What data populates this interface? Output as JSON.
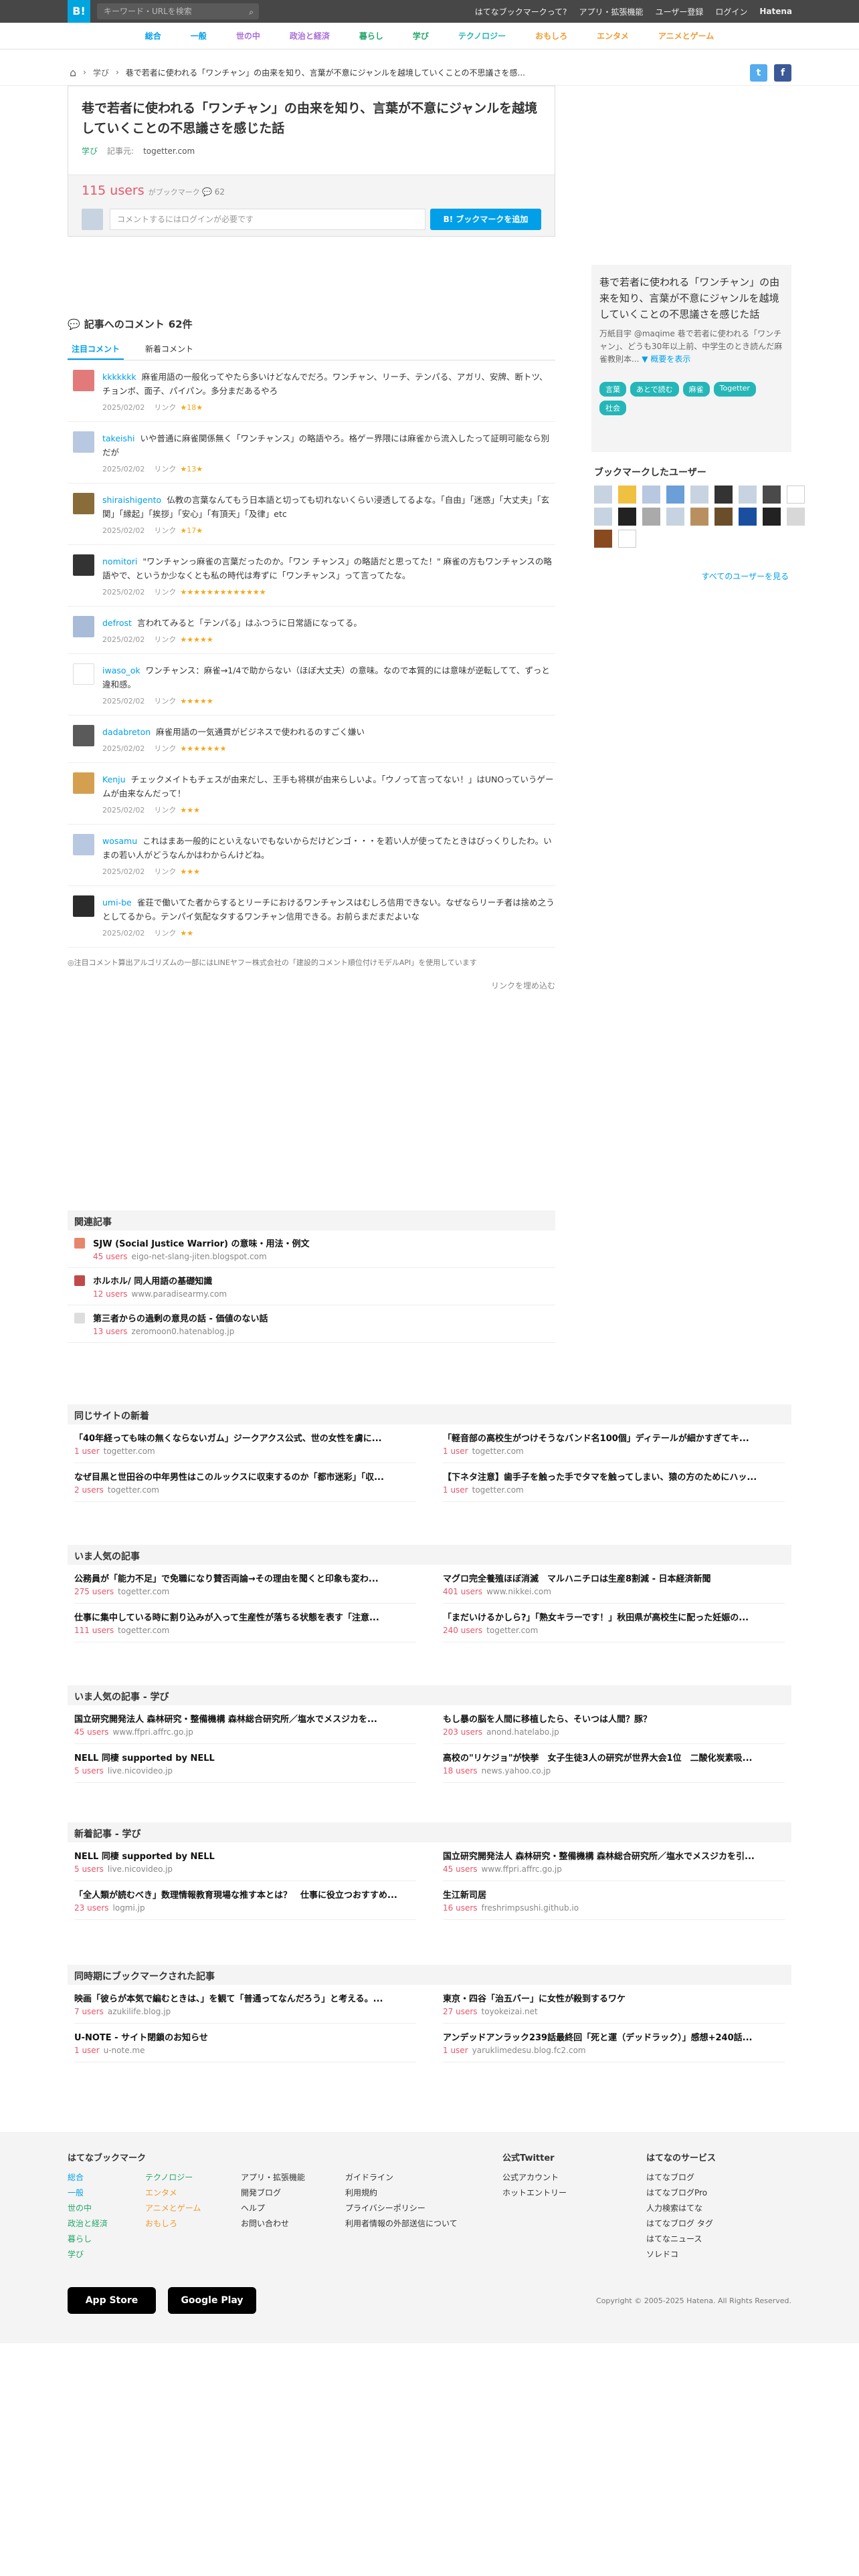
{
  "topbar": {
    "logo": "B!",
    "search_placeholder": "キーワード・URLを検索",
    "links": [
      "はてなブックマークって?",
      "アプリ・拡張機能",
      "ユーザー登録",
      "ログイン",
      "Hatena"
    ]
  },
  "nav": [
    "総合",
    "一般",
    "世の中",
    "政治と経済",
    "暮らし",
    "学び",
    "テクノロジー",
    "おもしろ",
    "エンタメ",
    "アニメとゲーム"
  ],
  "breadcrumb": {
    "home": "⌂",
    "category": "学び",
    "title": "巷で若者に使われる「ワンチャン」の由来を知り、言葉が不意にジャンルを越境していくことの不思議さを感..."
  },
  "share": {
    "twitter": "t",
    "facebook": "f"
  },
  "entry": {
    "title": "巷で若者に使われる「ワンチャン」の由来を知り、言葉が不意にジャンルを越境していくことの不思議さを感じた話",
    "category": "学び",
    "source_label": "記事元:",
    "domain": "togetter.com",
    "users": "115 users",
    "users_suffix": "がブックマーク",
    "comment_count": "62",
    "comment_placeholder": "コメントするにはログインが必要です",
    "add_button": "B! ブックマークを追加"
  },
  "comments": {
    "heading": "記事へのコメント",
    "count": "62件",
    "tabs": [
      "注目コメント",
      "新着コメント"
    ],
    "items": [
      {
        "user": "kkkkkkk",
        "text": "麻雀用語の一般化ってやたら多いけどなんでだろ。ワンチャン、リーチ、テンパる、アガリ、安牌、断トツ、チョンボ、面子、パイパン。多分まだあるやろ",
        "date": "2025/02/02",
        "link": "リンク",
        "stars": "★18★",
        "avatar_color": "#e27a7a"
      },
      {
        "user": "takeishi",
        "text": "いや普通に麻雀関係無く「ワンチャンス」の略語やろ。格ゲー界隈には麻雀から流入したって証明可能なら別だが",
        "date": "2025/02/02",
        "link": "リンク",
        "stars": "★13★",
        "avatar_color": "#b8c8e0"
      },
      {
        "user": "shiraishigento",
        "text": "仏教の言葉なんてもう日本語と切っても切れないくらい浸透してるよな。「自由」「迷惑」「大丈夫」「玄関」「縁起」「挨拶」「安心」「有頂天」「及律」etc",
        "date": "2025/02/02",
        "link": "リンク",
        "stars": "★17★",
        "avatar_color": "#8a6b3a"
      },
      {
        "user": "nomitori",
        "text": "\"ワンチャンっ麻雀の言葉だったのか。「ワン チャンス」の略語だと思ってた！\" 麻雀の方もワンチャンスの略語やで、というか少なくとも私の時代は寿ずに「ワンチャンス」って言ってたな。",
        "date": "2025/02/02",
        "link": "リンク",
        "stars": "★★★★★★★★★★★★★",
        "avatar_color": "#333333"
      },
      {
        "user": "defrost",
        "text": "言われてみると「テンパる」はふつうに日常語になってる。",
        "date": "2025/02/02",
        "link": "リンク",
        "stars": "★★★★★",
        "avatar_color": "#a8bcd8"
      },
      {
        "user": "iwaso_ok",
        "text": "ワンチャンス：麻雀→1/4で助からない（ほぼ大丈夫）の意味。なので本質的には意味が逆転してて、ずっと違和感。",
        "date": "2025/02/02",
        "link": "リンク",
        "stars": "★★★★★",
        "avatar_color": "#ffffff"
      },
      {
        "user": "dadabreton",
        "text": "麻雀用語の一気通貫がビジネスで使われるのすごく嫌い",
        "date": "2025/02/02",
        "link": "リンク",
        "stars": "★★★★★★★",
        "avatar_color": "#5a5a5a"
      },
      {
        "user": "Kenju",
        "text": "チェックメイトもチェスが由来だし、王手も将棋が由来らしいよ。「ウノって言ってない！」はUNOっていうゲームが由来なんだって！",
        "date": "2025/02/02",
        "link": "リンク",
        "stars": "★★★",
        "avatar_color": "#d4a050"
      },
      {
        "user": "wosamu",
        "text": "これはまあ一般的にといえないでもないからだけどンゴ・・・を若い人が使ってたときはびっくりしたわ。いまの若い人がどうなんかはわからんけどね。",
        "date": "2025/02/02",
        "link": "リンク",
        "stars": "★★★",
        "avatar_color": "#b8c8e0"
      },
      {
        "user": "umi-be",
        "text": "雀荘で働いてた者からするとリーチにおけるワンチャンスはむしろ信用できない。なぜならリーチ者は捨め之うとしてるから。テンパイ気配なタするワンチャン信用できる。お前らまだまだよいな",
        "date": "2025/02/02",
        "link": "リンク",
        "stars": "★★",
        "avatar_color": "#2b2b2b"
      }
    ],
    "note": "◎注目コメント算出アルゴリズムの一部にはLINEヤフー株式会社の「建設的コメント順位付けモデルAPI」を使用しています",
    "filter": "リンクを埋め込む"
  },
  "side": {
    "title": "巷で若者に使われる「ワンチャン」の由来を知り、言葉が不意にジャンルを越境していくことの不思議さを感じた話",
    "summary": "万紙目宇 @maqime 巷で若者に使われる「ワンチャン」、どうも30年以上前、中学生のとき読んだ麻雀教則本...",
    "more": "▼ 概要を表示",
    "tags": [
      "言葉",
      "あとで読む",
      "麻雀",
      "Togetter",
      "社会"
    ],
    "bm_heading": "ブックマークしたユーザー",
    "all_users": "すべてのユーザーを見る"
  },
  "related": {
    "heading": "関連記事",
    "items": [
      {
        "title": "SJW (Social Justice Warrior) の意味・用法・例文",
        "users": "45 users",
        "domain": "eigo-net-slang-jiten.blogspot.com"
      },
      {
        "title": "ホルホル/ 同人用語の基礎知識",
        "users": "12 users",
        "domain": "www.paradisearmy.com"
      },
      {
        "title": "第三者からの過剰の意見の話 - 価値のない話",
        "users": "13 users",
        "domain": "zeromoon0.hatenablog.jp"
      }
    ]
  },
  "sections": [
    {
      "heading": "同じサイトの新着",
      "items": [
        {
          "title": "「40年経っても味の無くならないガム」ジークアクス公式、世の女性を虜に...",
          "users": "1 user",
          "domain": "togetter.com"
        },
        {
          "title": "「軽音部の高校生がつけそうなバンド名100個」ディテールが細かすぎてキ...",
          "users": "1 user",
          "domain": "togetter.com"
        },
        {
          "title": "なぜ目黒と世田谷の中年男性はこのルックスに収束するのか「都市迷彩」「収...",
          "users": "2 users",
          "domain": "togetter.com"
        },
        {
          "title": "【下ネタ注意】歯手子を触った手でタマを触ってしまい、猿の方のためにハッ...",
          "users": "1 user",
          "domain": "togetter.com"
        }
      ]
    },
    {
      "heading": "いま人気の記事",
      "items": [
        {
          "title": "公務員が「能力不足」で免職になり賛否両論→その理由を聞くと印象も変わ...",
          "users": "275 users",
          "domain": "togetter.com"
        },
        {
          "title": "マグロ完全養殖ほぼ消滅　マルハニチロは生産8割減 - 日本経済新聞",
          "users": "401 users",
          "domain": "www.nikkei.com"
        },
        {
          "title": "仕事に集中している時に割り込みが入って生産性が落ちる状態を表す「注意...",
          "users": "111 users",
          "domain": "togetter.com"
        },
        {
          "title": "「まだいけるかしら?」「熟女キラーです！」秋田県が高校生に配った妊娠の...",
          "users": "240 users",
          "domain": "togetter.com"
        }
      ]
    },
    {
      "heading": "いま人気の記事 - 学び",
      "items": [
        {
          "title": "国立研究開発法人 森林研究・整備機構 森林総合研究所／塩水でメスジカを...",
          "users": "45 users",
          "domain": "www.ffpri.affrc.go.jp"
        },
        {
          "title": "もし暴の脳を人間に移植したら、そいつは人間？豚？",
          "users": "203 users",
          "domain": "anond.hatelabo.jp"
        },
        {
          "title": "NELL 同棲 supported by NELL",
          "users": "5 users",
          "domain": "live.nicovideo.jp"
        },
        {
          "title": "高校の\"リケジョ\"が快挙　女子生徒3人の研究が世界大会1位　二酸化炭素吸...",
          "users": "18 users",
          "domain": "news.yahoo.co.jp"
        }
      ]
    },
    {
      "heading": "新着記事 - 学び",
      "items": [
        {
          "title": "NELL 同棲 supported by NELL",
          "users": "5 users",
          "domain": "live.nicovideo.jp"
        },
        {
          "title": "国立研究開発法人 森林研究・整備機構 森林総合研究所／塩水でメスジカを引...",
          "users": "45 users",
          "domain": "www.ffpri.affrc.go.jp"
        },
        {
          "title": "「全人類が読むべき」数理情報教育現場な推す本とは？　仕事に役立つおすすめ...",
          "users": "23 users",
          "domain": "logmi.jp"
        },
        {
          "title": "生江新司居",
          "users": "16 users",
          "domain": "freshrimpsushi.github.io"
        }
      ]
    },
    {
      "heading": "同時期にブックマークされた記事",
      "items": [
        {
          "title": "映画「彼らが本気で編むときは、」を観て「普通ってなんだろう」と考える。...",
          "users": "7 users",
          "domain": "azukilife.blog.jp"
        },
        {
          "title": "東京・四谷「治五バー」に女性が殺到するワケ",
          "users": "27 users",
          "domain": "toyokeizai.net"
        },
        {
          "title": "U-NOTE - サイト閉鎖のお知らせ",
          "users": "1 user",
          "domain": "u-note.me"
        },
        {
          "title": "アンデッドアンラック239話最終回「死と運（デッドラック）」感想+240話...",
          "users": "1 user",
          "domain": "yaruklimedesu.blog.fc2.com"
        }
      ]
    }
  ],
  "footer": {
    "col1_head": "はてなブックマーク",
    "col1a": [
      "総合",
      "一般",
      "世の中",
      "政治と経済",
      "暮らし",
      "学び"
    ],
    "col1b": [
      "テクノロジー",
      "エンタメ",
      "アニメとゲーム",
      "おもしろ"
    ],
    "col2": [
      "アプリ・拡張機能",
      "開発ブログ",
      "ヘルプ",
      "お問い合わせ"
    ],
    "col3": [
      "ガイドライン",
      "利用規約",
      "プライバシーポリシー",
      "利用者情報の外部送信について"
    ],
    "col4_head": "公式Twitter",
    "col4": [
      "公式アカウント",
      "ホットエントリー"
    ],
    "col5_head": "はてなのサービス",
    "col5": [
      "はてなブログ",
      "はてなブログPro",
      "人力検索はてな",
      "はてなブログ タグ",
      "はてなニュース",
      "ソレドコ"
    ],
    "appstore": "App Store",
    "googleplay": "Google Play",
    "copyright": "Copyright © 2005-2025 Hatena. All Rights Reserved."
  }
}
